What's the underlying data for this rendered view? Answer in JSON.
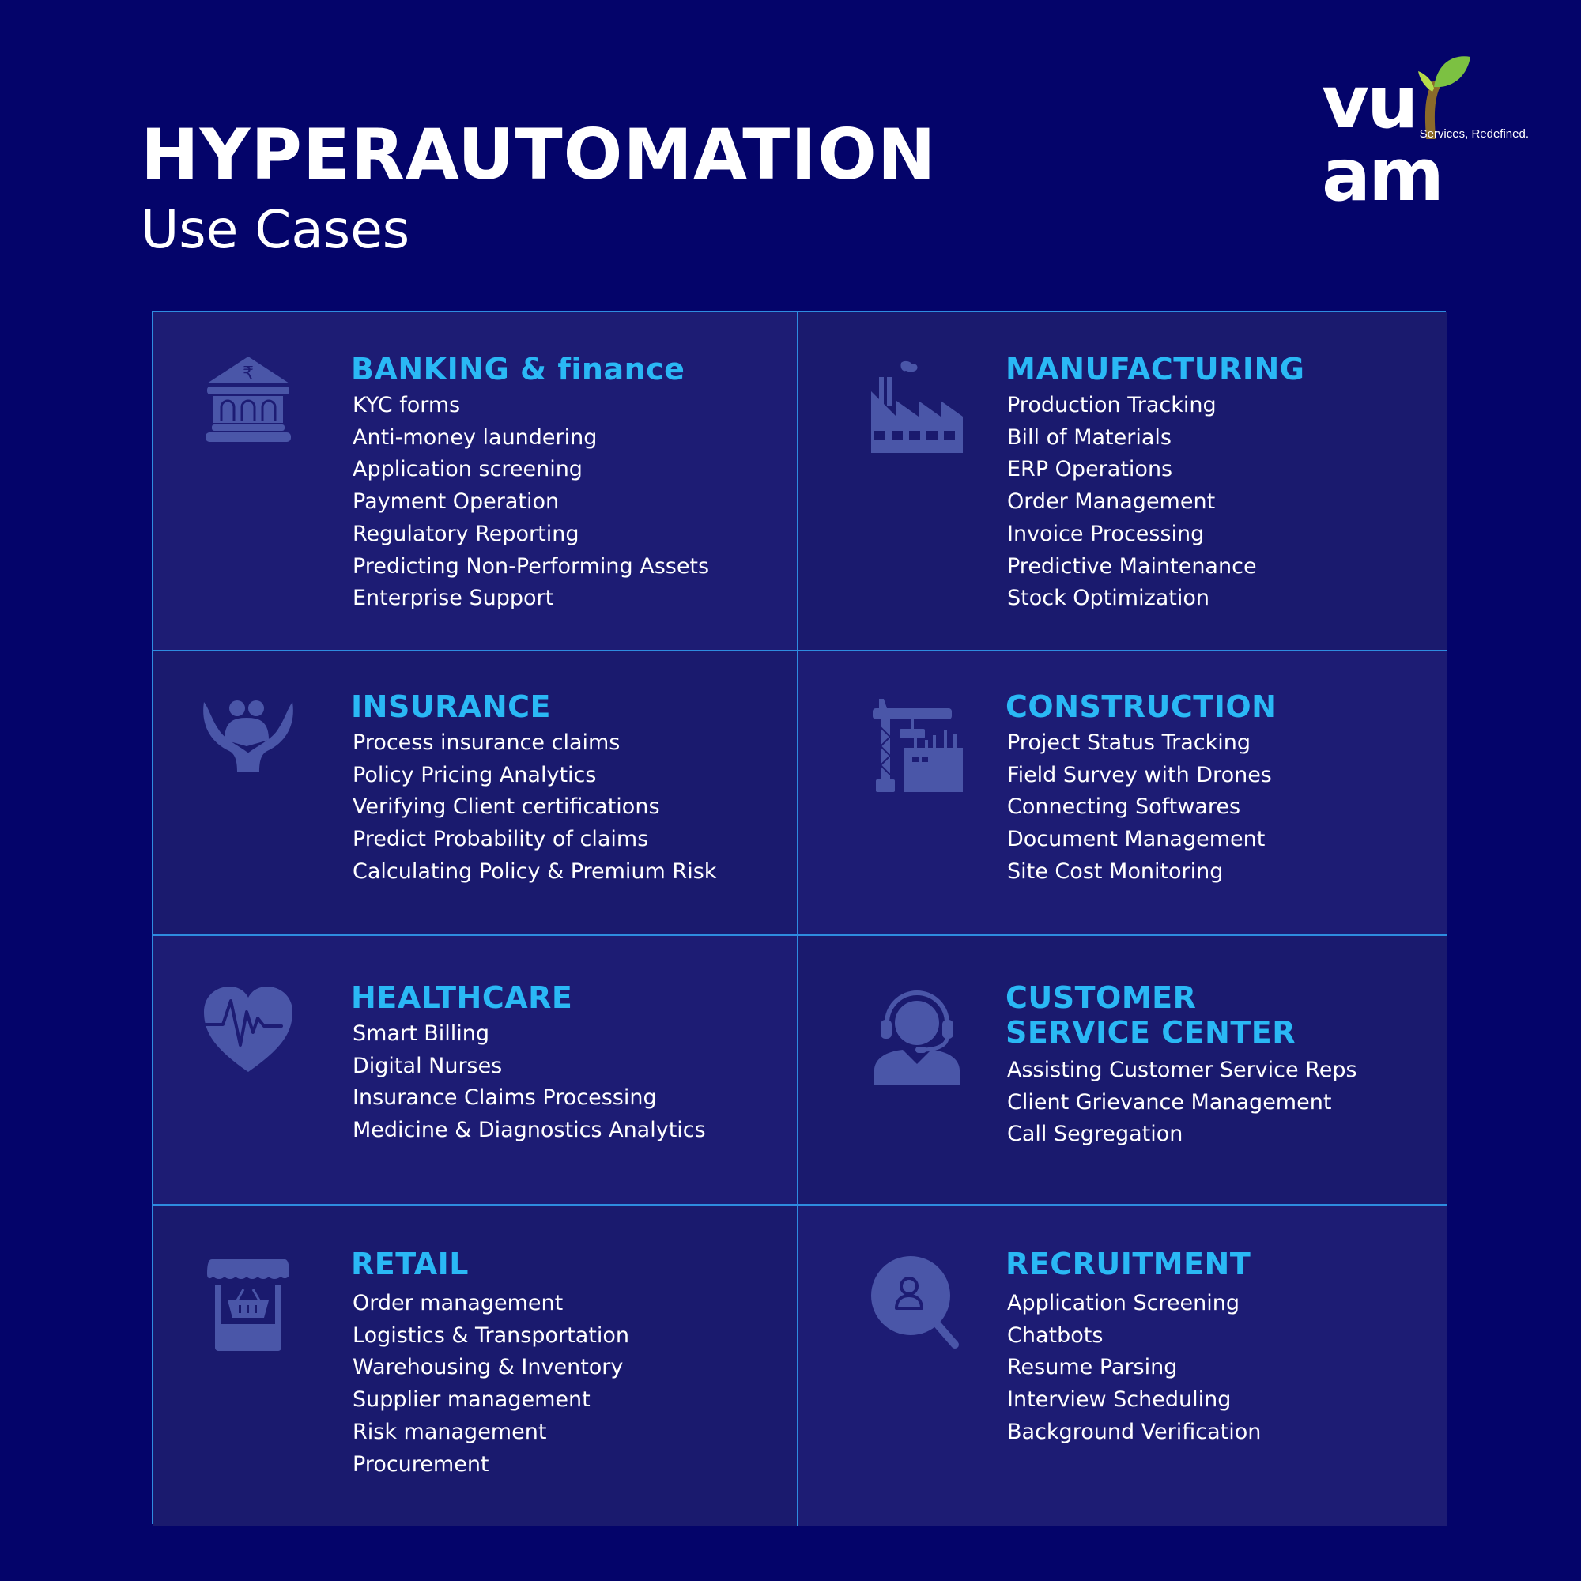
{
  "header": {
    "title": "HYPERAUTOMATION",
    "subtitle": "Use Cases"
  },
  "logo": {
    "wordmark": "vuram",
    "tagline": "Services, Redefined."
  },
  "colors": {
    "background": "#04046a",
    "panel": "#1d1c74",
    "border": "#2e8ce0",
    "heading": "#2ab8f5",
    "icon": "#4a56a8",
    "text": "#ffffff"
  },
  "sections": [
    {
      "heading": "BANKING & finance",
      "icon": "bank-rupee-icon",
      "items": [
        "KYC forms",
        "Anti-money laundering",
        "Application screening",
        "Payment Operation",
        "Regulatory Reporting",
        "Predicting Non-Performing Assets",
        "Enterprise Support"
      ]
    },
    {
      "heading": "MANUFACTURING",
      "icon": "factory-icon",
      "items": [
        "Production Tracking",
        "Bill of Materials",
        "ERP Operations",
        "Order Management",
        "Invoice Processing",
        "Predictive Maintenance",
        "Stock Optimization"
      ]
    },
    {
      "heading": "INSURANCE",
      "icon": "hands-family-icon",
      "items": [
        "Process insurance claims",
        "Policy Pricing Analytics",
        "Verifying Client certifications",
        "Predict Probability of claims",
        "Calculating Policy & Premium Risk"
      ]
    },
    {
      "heading": "CONSTRUCTION",
      "icon": "crane-building-icon",
      "items": [
        "Project Status Tracking",
        "Field Survey with Drones",
        "Connecting Softwares",
        "Document Management",
        "Site Cost Monitoring"
      ]
    },
    {
      "heading": "HEALTHCARE",
      "icon": "heart-pulse-icon",
      "items": [
        "Smart Billing",
        "Digital Nurses",
        "Insurance Claims Processing",
        "Medicine & Diagnostics Analytics"
      ]
    },
    {
      "heading": "CUSTOMER SERVICE CENTER",
      "icon": "headset-agent-icon",
      "items": [
        "Assisting Customer Service Reps",
        "Client Grievance Management",
        "Call Segregation"
      ]
    },
    {
      "heading": "RETAIL",
      "icon": "shop-basket-icon",
      "items": [
        "Order management",
        "Logistics & Transportation",
        "Warehousing & Inventory",
        "Supplier management",
        "Risk management",
        "Procurement"
      ]
    },
    {
      "heading": "RECRUITMENT",
      "icon": "search-person-icon",
      "items": [
        "Application Screening",
        "Chatbots",
        "Resume Parsing",
        "Interview Scheduling",
        "Background Verification"
      ]
    }
  ]
}
